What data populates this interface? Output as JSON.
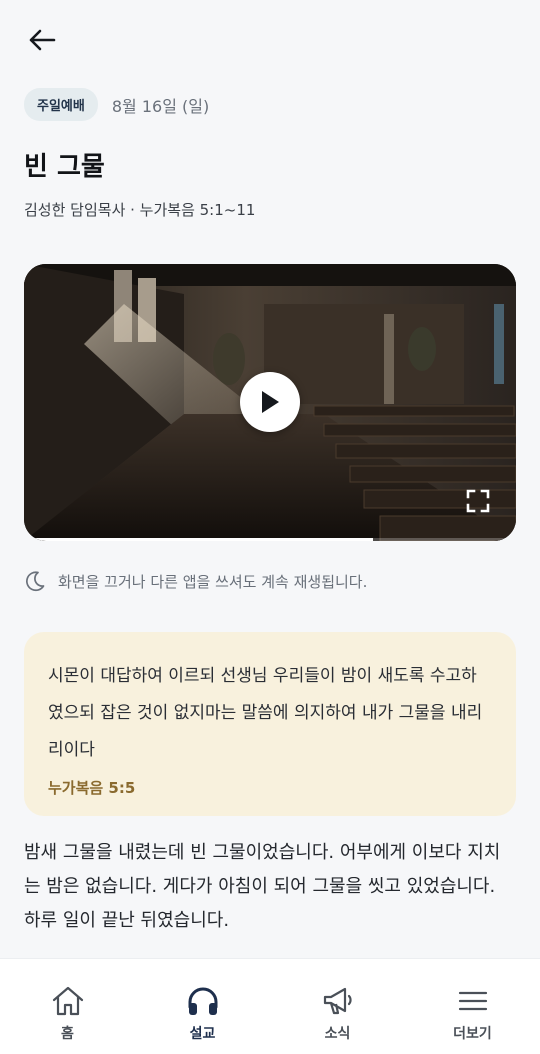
{
  "header": {
    "back_icon": "arrow-left-icon"
  },
  "sermon": {
    "category": "주일예배",
    "date": "8월 16일 (일)",
    "title": "빈 그물",
    "speaker_line": "김성한 담임목사 · 누가복음 5:1~11"
  },
  "video": {
    "play_icon": "play-icon",
    "fullscreen_icon": "fullscreen-icon",
    "progress": 0.71
  },
  "background_note": {
    "icon": "moon-icon",
    "text": "화면을 끄거나 다른 앱을 쓰셔도 계속 재생됩니다."
  },
  "verse": {
    "text": "시몬이 대답하여 이르되 선생님 우리들이 밤이 새도록 수고하였으되 잡은 것이 없지마는 말씀에 의지하여 내가 그물을 내리리이다",
    "reference": "누가복음 5:5"
  },
  "body": {
    "text": "밤새 그물을 내렸는데 빈 그물이었습니다. 어부에게 이보다 지치는 밤은 없습니다. 게다가 아침이 되어 그물을 씻고 있었습니다. 하루 일이 끝난 뒤였습니다."
  },
  "nav": {
    "items": [
      {
        "label": "홈",
        "icon": "home-icon"
      },
      {
        "label": "설교",
        "icon": "headphones-icon",
        "active": true
      },
      {
        "label": "소식",
        "icon": "megaphone-icon"
      },
      {
        "label": "더보기",
        "icon": "menu-icon"
      }
    ]
  },
  "colors": {
    "background": "#f6f7f9",
    "badge_bg": "#e5ecef",
    "verse_card_bg": "#f8f1dd",
    "verse_ref": "#8a6a2e",
    "nav_active": "#1e2f4d"
  }
}
